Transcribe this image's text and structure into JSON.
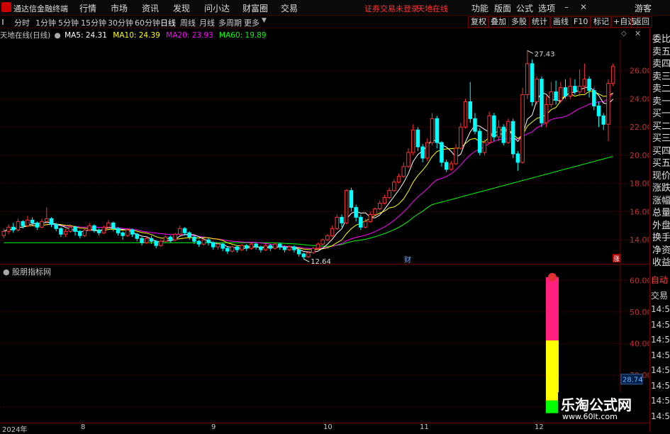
{
  "app": {
    "title": "通达信金融终端"
  },
  "menu": [
    "行情",
    "市场",
    "资讯",
    "发现",
    "问小达",
    "财富圈",
    "交易"
  ],
  "warning": {
    "text1": "证券交易未登录",
    "text2": "天地在线"
  },
  "right_menu": [
    "功能",
    "版面",
    "公式",
    "选项",
    "游客"
  ],
  "toolbar": {
    "periods": [
      "分时",
      "1分钟",
      "5分钟",
      "15分钟",
      "30分钟",
      "60分钟",
      "日线",
      "周线",
      "月线",
      "多周期",
      "更多"
    ],
    "active": "日线",
    "right": [
      "复权",
      "叠加",
      "多股",
      "统计",
      "画线",
      "F10",
      "标记",
      "+自选",
      "返回"
    ]
  },
  "legend": {
    "name": "天地在线(日线)",
    "ma5": "MA5: 24.31",
    "ma10": "MA10: 24.39",
    "ma20": "MA20: 23.93",
    "ma60": "MA60: 19.89",
    "colors": {
      "ma5": "#ffffff",
      "ma10": "#ffff00",
      "ma20": "#ff00ff",
      "ma60": "#00ff00"
    }
  },
  "right_panel": {
    "top": [
      "委比",
      "卖五",
      "卖四",
      "卖三",
      "卖二",
      "卖一",
      "买一",
      "买二",
      "买三",
      "买四",
      "买五",
      "现价",
      "涨跌",
      "涨幅",
      "总量",
      "外盘",
      "换手",
      "净资",
      "收益"
    ],
    "bottom": [
      "自动",
      "交易",
      "14:56",
      "14:56",
      "14:56",
      "14:56",
      "14:56",
      "14:56",
      "14:56",
      "14:56"
    ]
  },
  "chart_data": {
    "type": "candlestick",
    "title": "天地在线(日线)",
    "y_ticks": [
      "26.00",
      "24.00",
      "22.00",
      "20.00",
      "18.00",
      "16.00",
      "14.00"
    ],
    "x_ticks": [
      "2024年",
      "8",
      "9",
      "10",
      "11",
      "12"
    ],
    "annotations": {
      "high": "27.43",
      "low": "12.64",
      "event": "财",
      "zhang": "涨"
    },
    "ylim": [
      12.3,
      28.2
    ],
    "candles": [
      [
        14.3,
        14.6,
        14.1,
        14.8
      ],
      [
        14.6,
        14.9,
        14.4,
        15.1
      ],
      [
        14.9,
        14.7,
        14.5,
        15.2
      ],
      [
        14.7,
        15.3,
        14.6,
        15.5
      ],
      [
        15.3,
        15.0,
        14.8,
        15.4
      ],
      [
        15.0,
        15.4,
        14.9,
        15.7
      ],
      [
        15.4,
        15.2,
        15.0,
        15.6
      ],
      [
        15.2,
        14.9,
        14.7,
        15.3
      ],
      [
        14.9,
        15.3,
        14.8,
        15.5
      ],
      [
        15.3,
        15.5,
        15.1,
        16.3
      ],
      [
        15.5,
        15.1,
        14.9,
        15.6
      ],
      [
        15.1,
        14.8,
        14.6,
        15.2
      ],
      [
        14.8,
        14.4,
        14.2,
        14.9
      ],
      [
        14.4,
        14.6,
        14.2,
        14.8
      ],
      [
        14.6,
        14.9,
        14.5,
        15.1
      ],
      [
        14.9,
        14.6,
        14.3,
        15.0
      ],
      [
        14.6,
        14.3,
        14.1,
        14.7
      ],
      [
        14.3,
        14.7,
        14.2,
        14.9
      ],
      [
        14.7,
        15.0,
        14.6,
        15.2
      ],
      [
        15.0,
        14.7,
        14.5,
        15.1
      ],
      [
        14.7,
        14.5,
        14.3,
        14.8
      ],
      [
        14.5,
        14.9,
        14.4,
        15.0
      ],
      [
        14.9,
        15.2,
        14.8,
        15.4
      ],
      [
        15.2,
        14.8,
        14.6,
        15.3
      ],
      [
        14.8,
        14.5,
        14.3,
        14.9
      ],
      [
        14.5,
        14.3,
        14.0,
        14.6
      ],
      [
        14.3,
        14.7,
        14.2,
        14.8
      ],
      [
        14.7,
        14.4,
        14.2,
        14.8
      ],
      [
        14.4,
        14.1,
        13.9,
        14.5
      ],
      [
        14.1,
        13.8,
        13.6,
        14.2
      ],
      [
        13.8,
        14.1,
        13.7,
        14.2
      ],
      [
        14.1,
        13.9,
        13.7,
        14.3
      ],
      [
        13.9,
        13.6,
        13.4,
        14.0
      ],
      [
        13.6,
        13.9,
        13.5,
        14.0
      ],
      [
        13.9,
        14.2,
        13.8,
        14.3
      ],
      [
        14.2,
        14.0,
        13.8,
        14.3
      ],
      [
        14.0,
        14.4,
        13.9,
        14.5
      ],
      [
        14.4,
        14.8,
        14.3,
        15.0
      ],
      [
        14.8,
        14.5,
        14.3,
        14.9
      ],
      [
        14.5,
        14.2,
        14.0,
        14.6
      ],
      [
        14.2,
        13.9,
        13.7,
        14.3
      ],
      [
        13.9,
        13.7,
        13.5,
        14.0
      ],
      [
        13.7,
        14.0,
        13.6,
        14.1
      ],
      [
        14.0,
        13.8,
        13.6,
        14.1
      ],
      [
        13.8,
        13.5,
        13.3,
        13.9
      ],
      [
        13.5,
        13.7,
        13.3,
        13.8
      ],
      [
        13.7,
        13.4,
        13.2,
        13.8
      ],
      [
        13.4,
        13.2,
        13.0,
        13.5
      ],
      [
        13.2,
        13.5,
        13.1,
        13.6
      ],
      [
        13.5,
        13.3,
        13.1,
        13.6
      ],
      [
        13.3,
        13.6,
        13.2,
        13.7
      ],
      [
        13.6,
        13.4,
        13.2,
        13.7
      ],
      [
        13.4,
        13.7,
        13.3,
        13.8
      ],
      [
        13.7,
        13.5,
        13.3,
        13.8
      ],
      [
        13.5,
        13.3,
        13.1,
        13.6
      ],
      [
        13.3,
        13.6,
        13.2,
        13.7
      ],
      [
        13.6,
        13.4,
        13.2,
        13.7
      ],
      [
        13.4,
        13.7,
        13.3,
        13.8
      ],
      [
        13.7,
        13.5,
        13.3,
        13.8
      ],
      [
        13.5,
        13.3,
        13.1,
        13.6
      ],
      [
        13.3,
        13.5,
        13.2,
        13.6
      ],
      [
        13.5,
        13.3,
        13.1,
        13.6
      ],
      [
        13.3,
        13.0,
        12.8,
        13.4
      ],
      [
        13.0,
        12.8,
        12.64,
        13.1
      ],
      [
        12.8,
        13.1,
        12.7,
        13.2
      ],
      [
        13.1,
        13.4,
        13.0,
        13.5
      ],
      [
        13.4,
        13.7,
        13.3,
        13.8
      ],
      [
        13.7,
        14.0,
        13.6,
        14.1
      ],
      [
        14.0,
        14.3,
        13.9,
        14.4
      ],
      [
        14.3,
        14.8,
        14.2,
        15.0
      ],
      [
        14.8,
        15.6,
        14.7,
        15.8
      ],
      [
        15.6,
        15.2,
        14.9,
        15.8
      ],
      [
        15.2,
        17.5,
        15.1,
        17.6
      ],
      [
        17.5,
        16.3,
        16.0,
        17.7
      ],
      [
        16.3,
        15.6,
        15.3,
        16.5
      ],
      [
        15.6,
        14.9,
        14.7,
        15.8
      ],
      [
        14.9,
        15.3,
        14.8,
        15.5
      ],
      [
        15.3,
        15.8,
        15.2,
        16.0
      ],
      [
        15.8,
        16.2,
        15.7,
        16.3
      ],
      [
        16.2,
        16.6,
        16.1,
        16.8
      ],
      [
        16.6,
        17.0,
        16.5,
        17.2
      ],
      [
        17.0,
        17.5,
        16.9,
        17.7
      ],
      [
        17.5,
        18.1,
        17.4,
        18.3
      ],
      [
        18.1,
        18.5,
        18.0,
        18.7
      ],
      [
        18.5,
        19.2,
        18.4,
        19.5
      ],
      [
        19.2,
        20.2,
        19.1,
        20.5
      ],
      [
        20.2,
        21.8,
        20.0,
        22.2
      ],
      [
        21.8,
        20.6,
        20.3,
        22.0
      ],
      [
        20.6,
        19.8,
        19.5,
        20.8
      ],
      [
        19.8,
        20.9,
        19.6,
        21.2
      ],
      [
        20.9,
        22.6,
        20.7,
        23.0
      ],
      [
        22.6,
        20.9,
        20.5,
        22.8
      ],
      [
        20.9,
        19.5,
        19.2,
        21.0
      ],
      [
        19.5,
        19.0,
        18.8,
        19.7
      ],
      [
        19.0,
        19.4,
        18.9,
        19.6
      ],
      [
        19.4,
        20.5,
        19.3,
        20.8
      ],
      [
        20.5,
        22.0,
        20.4,
        22.3
      ],
      [
        22.0,
        23.8,
        21.9,
        24.0
      ],
      [
        23.8,
        22.6,
        22.3,
        25.2
      ],
      [
        22.6,
        21.7,
        21.5,
        23.0
      ],
      [
        21.7,
        20.2,
        20.0,
        21.9
      ],
      [
        20.2,
        20.9,
        20.0,
        21.1
      ],
      [
        20.9,
        22.8,
        20.8,
        23.1
      ],
      [
        22.8,
        21.3,
        21.0,
        23.0
      ],
      [
        21.3,
        22.0,
        21.0,
        22.5
      ],
      [
        22.0,
        20.9,
        20.7,
        22.2
      ],
      [
        20.9,
        22.4,
        20.8,
        22.6
      ],
      [
        22.4,
        20.1,
        19.8,
        22.6
      ],
      [
        20.1,
        19.5,
        18.9,
        20.3
      ],
      [
        19.5,
        24.3,
        19.4,
        24.8
      ],
      [
        24.3,
        26.5,
        24.0,
        27.43
      ],
      [
        26.5,
        23.8,
        23.5,
        26.8
      ],
      [
        23.8,
        25.4,
        23.6,
        25.6
      ],
      [
        25.4,
        22.3,
        22.0,
        25.6
      ],
      [
        22.3,
        23.6,
        22.0,
        24.2
      ],
      [
        23.6,
        24.5,
        23.4,
        25.2
      ],
      [
        24.5,
        23.9,
        23.6,
        25.3
      ],
      [
        23.9,
        24.8,
        23.7,
        25.2
      ],
      [
        24.8,
        24.2,
        24.0,
        25.4
      ],
      [
        24.2,
        24.9,
        24.0,
        25.5
      ],
      [
        24.9,
        24.5,
        24.3,
        25.4
      ],
      [
        24.5,
        24.9,
        24.2,
        26.1
      ],
      [
        24.9,
        25.4,
        24.4,
        26.5
      ],
      [
        25.4,
        24.6,
        24.1,
        25.6
      ],
      [
        24.6,
        23.5,
        23.2,
        24.8
      ],
      [
        23.5,
        22.8,
        22.0,
        23.8
      ],
      [
        22.8,
        22.2,
        21.8,
        23.0
      ],
      [
        22.2,
        25.1,
        21.0,
        25.4
      ],
      [
        25.1,
        26.3,
        24.9,
        26.5
      ]
    ],
    "indicator": {
      "name": "股朋指标网",
      "ylim": [
        15,
        65
      ],
      "y_ticks": [
        "60.00",
        "50.00",
        "40.00",
        "30.00",
        "20.00"
      ],
      "current": "28.74",
      "segments": [
        {
          "from": 18,
          "to": 22,
          "color": "#00ff00"
        },
        {
          "from": 22,
          "to": 41,
          "color": "#ffff00"
        },
        {
          "from": 41,
          "to": 61,
          "color": "#ff1f7f"
        }
      ]
    }
  },
  "watermark": {
    "title": "乐淘公式网",
    "url": "www.60lt.com"
  }
}
